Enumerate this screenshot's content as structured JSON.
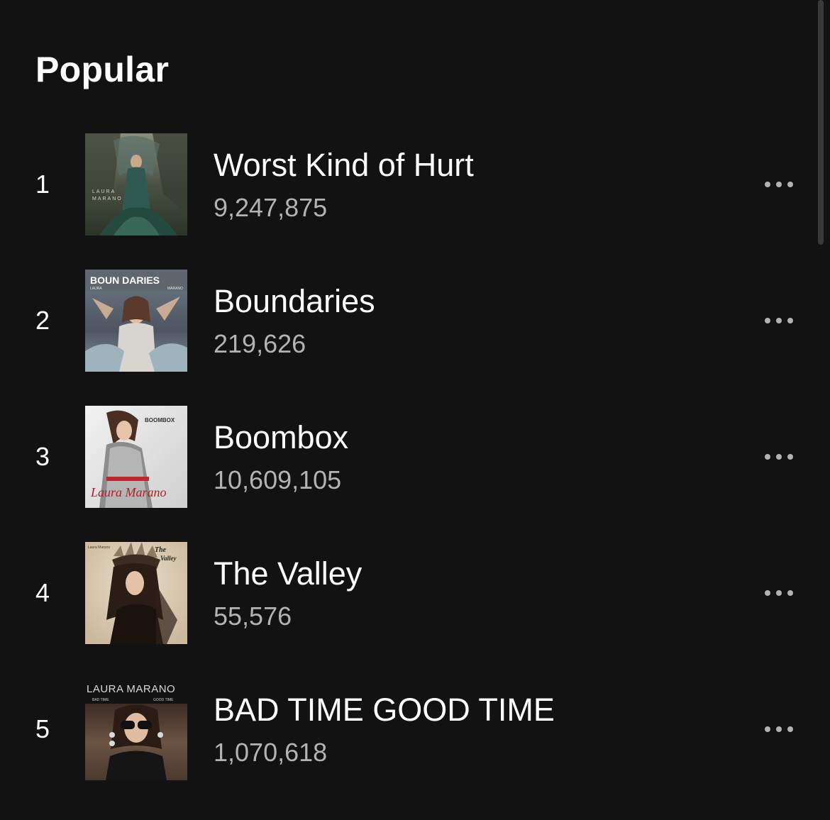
{
  "section": {
    "title": "Popular"
  },
  "tracks": [
    {
      "rank": "1",
      "title": "Worst Kind of Hurt",
      "plays": "9,247,875",
      "art_icon": "album-cover-worst-kind-of-hurt",
      "art_text": [
        "LAURA",
        "MARANO"
      ]
    },
    {
      "rank": "2",
      "title": "Boundaries",
      "plays": "219,626",
      "art_icon": "album-cover-boundaries",
      "art_text": [
        "BOUN DARIES",
        "LAURA",
        "MARANO"
      ]
    },
    {
      "rank": "3",
      "title": "Boombox",
      "plays": "10,609,105",
      "art_icon": "album-cover-boombox",
      "art_text": [
        "BOOMBOX",
        "Laura Marano"
      ]
    },
    {
      "rank": "4",
      "title": "The Valley",
      "plays": "55,576",
      "art_icon": "album-cover-the-valley",
      "art_text": [
        "Laura Marano",
        "The",
        "Valley"
      ]
    },
    {
      "rank": "5",
      "title": "BAD TIME GOOD TIME",
      "plays": "1,070,618",
      "art_icon": "album-cover-bad-time-good-time",
      "art_text": [
        "LAURA MARANO",
        "BAD TIME",
        "GOOD TIME"
      ]
    }
  ],
  "colors": {
    "background": "#121212",
    "text_primary": "#ffffff",
    "text_secondary": "#b3b3b3"
  }
}
